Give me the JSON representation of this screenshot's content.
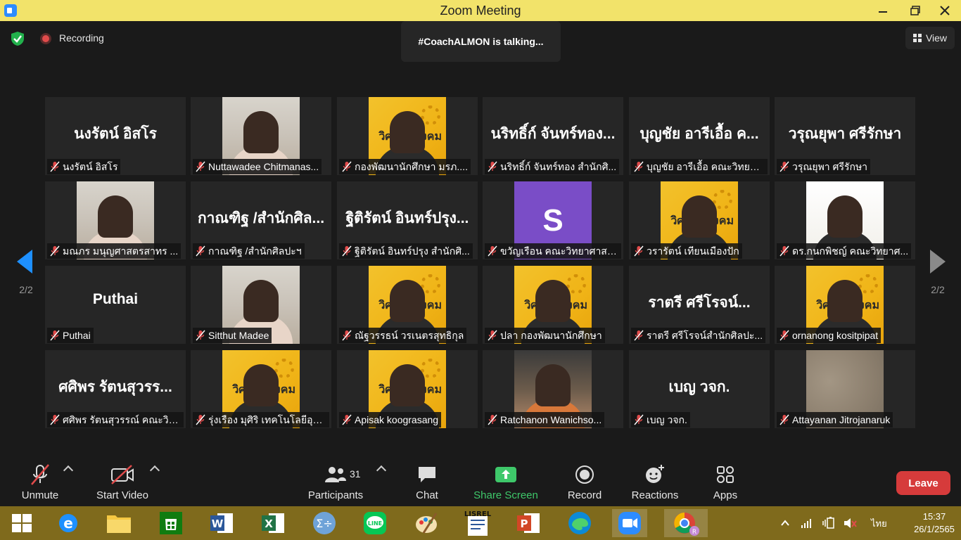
{
  "window": {
    "title": "Zoom Meeting"
  },
  "meeting": {
    "recording_label": "Recording",
    "talking_banner": "#CoachALMON is talking...",
    "view_label": "View",
    "page_left": "2/2",
    "page_right": "2/2"
  },
  "tiles": [
    {
      "big": "นงรัตน์ อิสโร",
      "label": "นงรัตน์ อิสโร",
      "photo": "none"
    },
    {
      "big": "",
      "label": "Nuttawadee Chitmanas...",
      "photo": "office"
    },
    {
      "big": "",
      "label": "กองพัฒนานักศึกษา มรภ....",
      "photo": "yellow"
    },
    {
      "big": "นริทธิ์ก์ จันทร์ทอง...",
      "label": "นริทธิ์ก์ จันทร์ทอง สำนักศิ...",
      "photo": "none"
    },
    {
      "big": "บุญชัย อารีเอื้อ ค...",
      "label": "บุญชัย อารีเอื้อ คณะวิทยาศ...",
      "photo": "none"
    },
    {
      "big": "วรุณยุพา ศรีรักษา",
      "label": "วรุณยุพา ศรีรักษา",
      "photo": "none"
    },
    {
      "big": "",
      "label": "มณภร มนุญศาสตรสาทร ...",
      "photo": "office"
    },
    {
      "big": "กาณฑิฐ /สำนักศิล...",
      "label": "กาณฑิฐ /สำนักศิลปะฯ",
      "photo": "none"
    },
    {
      "big": "ฐิติรัตน์ อินทร์ปรุง...",
      "label": "ฐิติรัตน์ อินทร์ปรุง สำนักศิ...",
      "photo": "none"
    },
    {
      "big": "",
      "label": "ขวัญเรือน คณะวิทยาศาสต...",
      "photo": "purple",
      "initial": "S"
    },
    {
      "big": "",
      "label": "วรารัตน์ เทียนเมืองปัก",
      "photo": "yellow"
    },
    {
      "big": "",
      "label": "ดร.กนกพิชญ์ คณะวิทยาศ...",
      "photo": "white"
    },
    {
      "big": "Puthai",
      "label": "Puthai",
      "photo": "none"
    },
    {
      "big": "",
      "label": "Sitthut Madee",
      "photo": "office"
    },
    {
      "big": "",
      "label": "ณัฐวรรธน์ วรเนตรสุทธิกุล",
      "photo": "yellow"
    },
    {
      "big": "",
      "label": "ปลา กองพัฒนานักศึกษา",
      "photo": "yellow"
    },
    {
      "big": "ราตรี  ศรีโรจน์...",
      "label": "ราตรี   ศรีโรจน์สำนักศิลปะ...",
      "photo": "none"
    },
    {
      "big": "",
      "label": "ornanong kositpipat",
      "photo": "yellow"
    },
    {
      "big": "ศศิพร รัตนสุวรร...",
      "label": "ศศิพร รัตนสุวรรณ์ คณะวิท...",
      "photo": "none"
    },
    {
      "big": "",
      "label": "รุ่งเรือง มุศิริ เทคโนโลยีอุตส...",
      "photo": "yellow"
    },
    {
      "big": "",
      "label": "Apisak koograsang",
      "photo": "yellow"
    },
    {
      "big": "",
      "label": "Ratchanon Wanichso...",
      "photo": "restaurant"
    },
    {
      "big": "เบญ วจก.",
      "label": "เบญ วจก.",
      "photo": "none"
    },
    {
      "big": "",
      "label": "Attayanan Jitrojanaruk",
      "photo": "sand"
    }
  ],
  "photo_brand_text": "วิศวกร สังคม",
  "toolbar": {
    "unmute": "Unmute",
    "start_video": "Start Video",
    "participants": "Participants",
    "participants_count": "31",
    "chat": "Chat",
    "share_screen": "Share Screen",
    "record": "Record",
    "reactions": "Reactions",
    "apps": "Apps",
    "leave": "Leave"
  },
  "taskbar": {
    "language": "ไทย",
    "time": "15:37",
    "date": "26/1/2565",
    "apps": [
      "windows-start",
      "internet-explorer",
      "file-explorer",
      "microsoft-store",
      "word",
      "excel",
      "math-input",
      "line",
      "paint",
      "lisrel",
      "powerpoint",
      "edge",
      "zoom",
      "chrome"
    ]
  },
  "colors": {
    "title_bar": "#f2e36a",
    "taskbar": "#7f6a1c",
    "leave": "#d63b3b",
    "share_green": "#3ec86a",
    "accent_blue": "#1e90ff"
  }
}
